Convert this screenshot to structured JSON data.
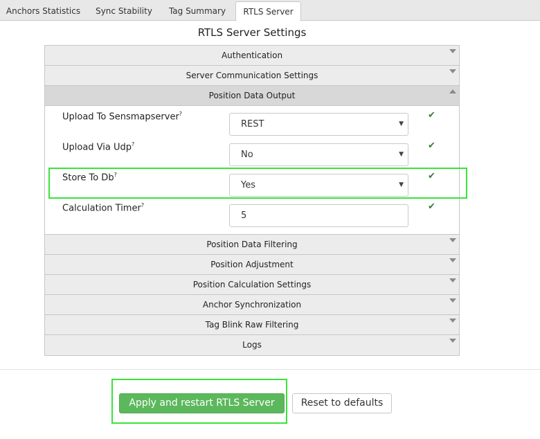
{
  "tabs": [
    {
      "label": "Anchors Statistics",
      "active": false
    },
    {
      "label": "Sync Stability",
      "active": false
    },
    {
      "label": "Tag Summary",
      "active": false
    },
    {
      "label": "RTLS Server",
      "active": true
    }
  ],
  "page_title": "RTLS Server Settings",
  "sections_before": [
    {
      "label": "Authentication",
      "expanded": false
    },
    {
      "label": "Server Communication Settings",
      "expanded": false
    }
  ],
  "open_section": {
    "label": "Position Data Output",
    "expanded": true,
    "fields": [
      {
        "label": "Upload To Sensmapserver",
        "hint": "?",
        "value": "REST",
        "type": "select",
        "status": "✔"
      },
      {
        "label": "Upload Via Udp",
        "hint": "?",
        "value": "No",
        "type": "select",
        "status": "✔"
      },
      {
        "label": "Store To Db",
        "hint": "?",
        "value": "Yes",
        "type": "select",
        "status": "✔",
        "highlighted": true
      },
      {
        "label": "Calculation Timer",
        "hint": "?",
        "value": "5",
        "type": "input",
        "status": "✔"
      }
    ]
  },
  "sections_after": [
    {
      "label": "Position Data Filtering",
      "expanded": false
    },
    {
      "label": "Position Adjustment",
      "expanded": false
    },
    {
      "label": "Position Calculation Settings",
      "expanded": false
    },
    {
      "label": "Anchor Synchronization",
      "expanded": false
    },
    {
      "label": "Tag Blink Raw Filtering",
      "expanded": false
    },
    {
      "label": "Logs",
      "expanded": false
    }
  ],
  "buttons": {
    "apply": "Apply and restart RTLS Server",
    "reset": "Reset to defaults"
  },
  "icons": {
    "select_caret": "▼",
    "check": "✔"
  },
  "colors": {
    "accent_green": "#5cb85c",
    "highlight": "#39e339",
    "check": "#3a7a3a"
  }
}
